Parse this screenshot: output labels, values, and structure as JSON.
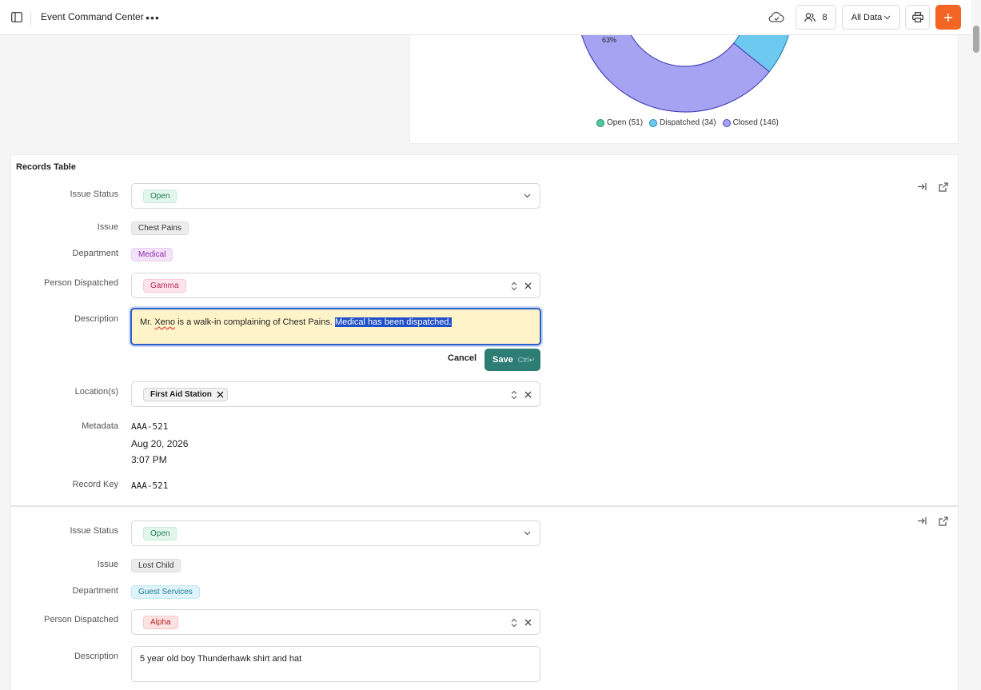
{
  "topbar": {
    "title": "Event Command Center",
    "users_count": "8",
    "data_filter": "All Data"
  },
  "chart_data": {
    "type": "pie",
    "slices": [
      {
        "name": "Open",
        "value": 51,
        "color": "#4cc99e"
      },
      {
        "name": "Dispatched",
        "value": 34,
        "color": "#6ec9f0"
      },
      {
        "name": "Closed",
        "value": 146,
        "color": "#a5a3f2"
      }
    ],
    "closed_pct_label": "63%",
    "legend": [
      "Open (51)",
      "Dispatched (34)",
      "Closed (146)"
    ]
  },
  "records": {
    "title": "Records Table",
    "labels": {
      "issue_status": "Issue Status",
      "issue": "Issue",
      "department": "Department",
      "person_dispatched": "Person Dispatched",
      "description": "Description",
      "locations": "Location(s)",
      "metadata": "Metadata",
      "record_key": "Record Key"
    },
    "first": {
      "issue_status": "Open",
      "issue": "Chest Pains",
      "department": "Medical",
      "person_dispatched": "Gamma",
      "description_pre": "Mr. ",
      "description_misspelled": "Xeno",
      "description_mid": " is a walk-in complaining of Chest Pains. ",
      "description_selected": "Medical has been dispatched.",
      "cancel": "Cancel",
      "save": "Save",
      "save_hint": "Ctrl↵",
      "location": "First Aid Station",
      "meta_id": "AAA-521",
      "meta_date": "Aug 20, 2026",
      "meta_time": "3:07 PM",
      "record_key": "AAA-521"
    },
    "second": {
      "issue_status": "Open",
      "issue": "Lost Child",
      "department": "Guest Services",
      "person_dispatched": "Alpha",
      "description": "5 year old boy Thunderhawk shirt and hat"
    }
  }
}
